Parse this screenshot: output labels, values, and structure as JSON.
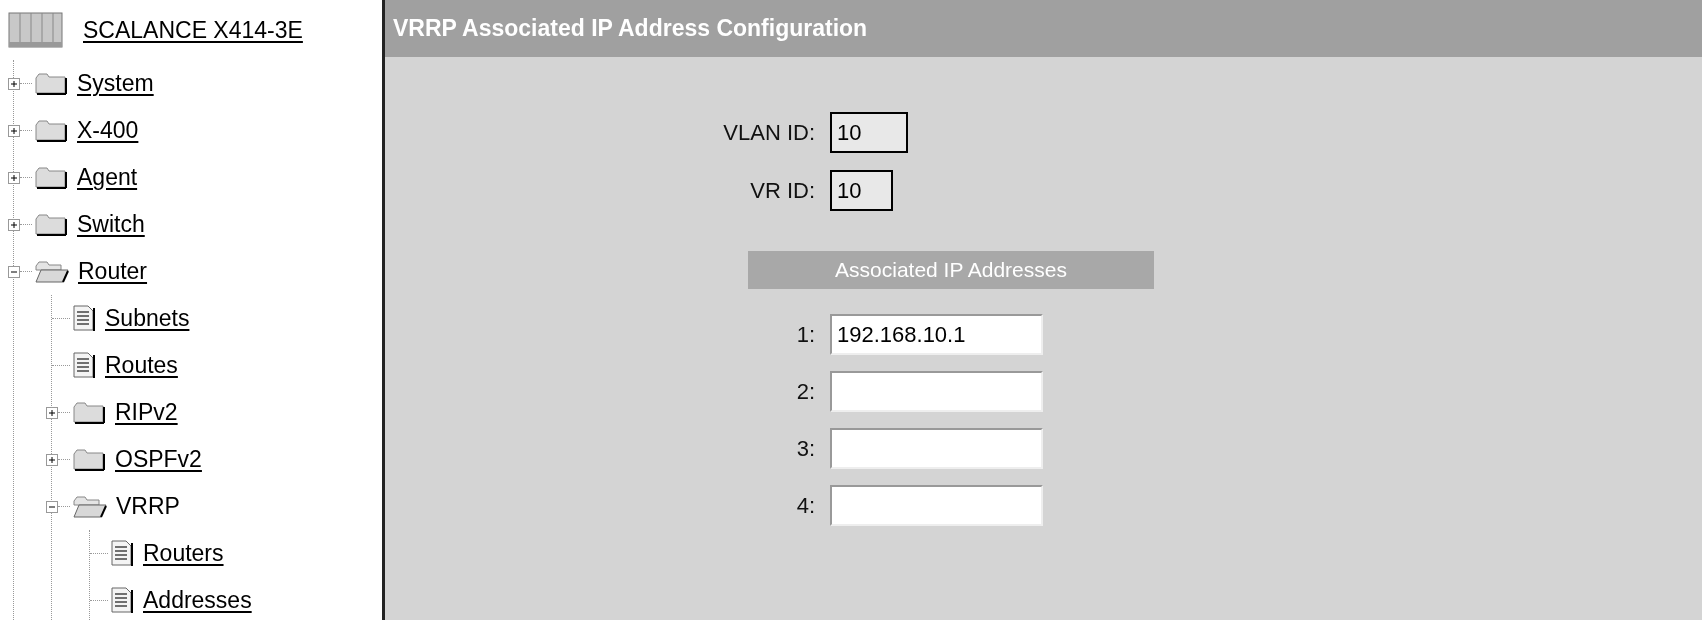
{
  "sidebar": {
    "tree": [
      {
        "label": "SCALANCE X414-3E",
        "kind": "device",
        "link": true,
        "children": [
          {
            "label": "System",
            "kind": "folder",
            "link": true,
            "expanded": false
          },
          {
            "label": "X-400",
            "kind": "folder",
            "link": true,
            "expanded": false
          },
          {
            "label": "Agent",
            "kind": "folder",
            "link": true,
            "expanded": false
          },
          {
            "label": "Switch",
            "kind": "folder",
            "link": true,
            "expanded": false
          },
          {
            "label": "Router",
            "kind": "folder",
            "link": true,
            "expanded": true,
            "children": [
              {
                "label": "Subnets",
                "kind": "page",
                "link": true
              },
              {
                "label": "Routes",
                "kind": "page",
                "link": true
              },
              {
                "label": "RIPv2",
                "kind": "folder",
                "link": true,
                "expanded": false
              },
              {
                "label": "OSPFv2",
                "kind": "folder",
                "link": true,
                "expanded": false
              },
              {
                "label": "VRRP",
                "kind": "folder",
                "link": false,
                "expanded": true,
                "children": [
                  {
                    "label": "Routers",
                    "kind": "page",
                    "link": true
                  },
                  {
                    "label": "Addresses",
                    "kind": "page",
                    "link": true
                  }
                ]
              }
            ]
          }
        ]
      }
    ]
  },
  "main": {
    "title": "VRRP Associated IP Address Configuration",
    "fields": [
      {
        "label": "VLAN ID:",
        "value": "10",
        "readonly": true
      },
      {
        "label": "VR ID:",
        "value": "10",
        "readonly": true
      }
    ],
    "section": {
      "title": "Associated IP Addresses",
      "fields": [
        {
          "label": "1:",
          "value": "192.168.10.1",
          "readonly": false
        },
        {
          "label": "2:",
          "readonly": false
        },
        {
          "label": "3:",
          "readonly": false
        },
        {
          "label": "4:",
          "readonly": false
        }
      ]
    }
  }
}
